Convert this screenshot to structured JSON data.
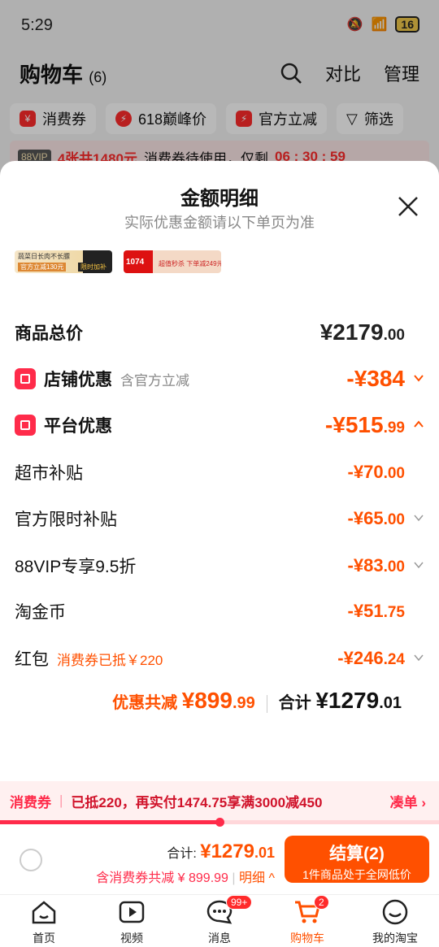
{
  "status_bar": {
    "time": "5:29",
    "battery": "16"
  },
  "cart": {
    "title": "购物车",
    "count": "(6)",
    "actions": [
      "对比",
      "管理"
    ],
    "filters": [
      {
        "label": "消费券",
        "icon": "coupon-icon"
      },
      {
        "label": "618巅峰价",
        "icon": "flash-icon"
      },
      {
        "label": "官方立减",
        "icon": "flash-icon"
      }
    ],
    "filter_button": "筛选",
    "vip_banner": {
      "tag": "88VIP",
      "highlight": "4张共1480元",
      "text": "消费券待使用，仅剩",
      "countdown": "06 : 30 : 59"
    }
  },
  "sheet": {
    "title": "金额明细",
    "subtitle": "实际优惠金额请以下单页为准",
    "thumbs": [
      {
        "top": "蔬菜日长肉不长膘",
        "bottom": "官方立减130元",
        "tag": "限时加补"
      },
      {
        "top": "1074",
        "bottom": "超值秒杀 下单减249元"
      }
    ],
    "rows": [
      {
        "label": "商品总价",
        "amount_int": "¥2179",
        "amount_dec": ".00"
      },
      {
        "label": "店铺优惠",
        "note": "含官方立减",
        "amount_int": "-¥384",
        "amount_dec": ""
      },
      {
        "label": "平台优惠",
        "amount_int": "-¥515",
        "amount_dec": ".99"
      },
      {
        "label": "超市补贴",
        "amount_int": "-¥70",
        "amount_dec": ".00"
      },
      {
        "label": "官方限时补贴",
        "amount_int": "-¥65",
        "amount_dec": ".00"
      },
      {
        "label": "88VIP专享9.5折",
        "amount_int": "-¥83",
        "amount_dec": ".00"
      },
      {
        "label": "淘金币",
        "amount_int": "-¥51",
        "amount_dec": ".75"
      },
      {
        "label": "红包",
        "note": "消费券已抵￥220",
        "amount_int": "-¥246",
        "amount_dec": ".24"
      }
    ],
    "discount_label": "优惠共减",
    "discount_int": "¥899",
    "discount_dec": ".99",
    "total_label": "合计",
    "total_int": "¥1279",
    "total_dec": ".01"
  },
  "coupon_bar": {
    "label": "消费券",
    "text": "已抵220，再实付1474.75享满3000减450",
    "link": "凑单",
    "progress_fraction": 0.5
  },
  "checkout": {
    "total_label": "合计:",
    "total_int": "¥1279",
    "total_dec": ".01",
    "sub": "含消费券共减 ¥ 899.99",
    "detail": "明细",
    "button_main": "结算(2)",
    "button_sub": "1件商品处于全网低价"
  },
  "tabbar": [
    {
      "label": "首页",
      "icon": "home-icon"
    },
    {
      "label": "视频",
      "icon": "video-icon"
    },
    {
      "label": "消息",
      "icon": "message-icon",
      "badge": "99+"
    },
    {
      "label": "购物车",
      "icon": "cart-icon",
      "badge": "2",
      "active": true
    },
    {
      "label": "我的淘宝",
      "icon": "profile-icon"
    }
  ],
  "colors": {
    "accent": "#ff5000",
    "red": "#ff2b4a"
  }
}
